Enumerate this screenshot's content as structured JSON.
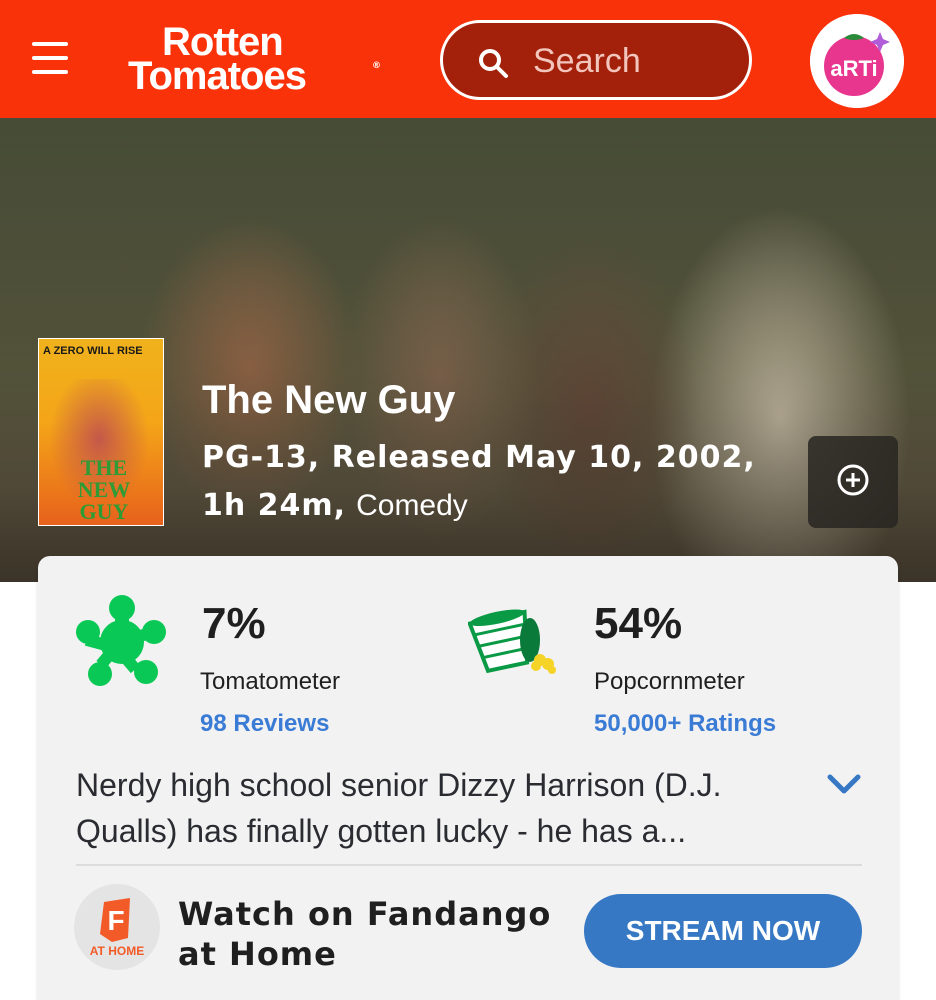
{
  "header": {
    "logo_line1": "Rotten",
    "logo_line2": "Tomatoes",
    "logo_reg": "®",
    "search_placeholder": "Search",
    "avatar_text": "aRTi",
    "brand_color": "#fa320a"
  },
  "movie": {
    "title": "The New Guy",
    "meta_line1": "PG-13, Released May 10, 2002,",
    "runtime": "1h 24m,",
    "genre": "Comedy",
    "poster_tagline": "A ZERO WILL RISE",
    "poster_title": "THE NEW GUY"
  },
  "scores": {
    "tomatometer": {
      "value": "7%",
      "label": "Tomatometer",
      "link": "98 Reviews",
      "icon": "splat-icon",
      "color": "#0ac855"
    },
    "popcornmeter": {
      "value": "54%",
      "label": "Popcornmeter",
      "link": "50,000+ Ratings",
      "icon": "spilled-popcorn-icon",
      "color": "#0ac855"
    }
  },
  "synopsis": {
    "line1": "Nerdy high school senior Dizzy Harrison (D.J.",
    "line2": "Qualls) has finally gotten lucky - he has a..."
  },
  "watch": {
    "logo_label": "AT HOME",
    "text_line1": "Watch on Fandango",
    "text_line2": "at Home",
    "button": "STREAM NOW",
    "button_color": "#3678c4"
  }
}
